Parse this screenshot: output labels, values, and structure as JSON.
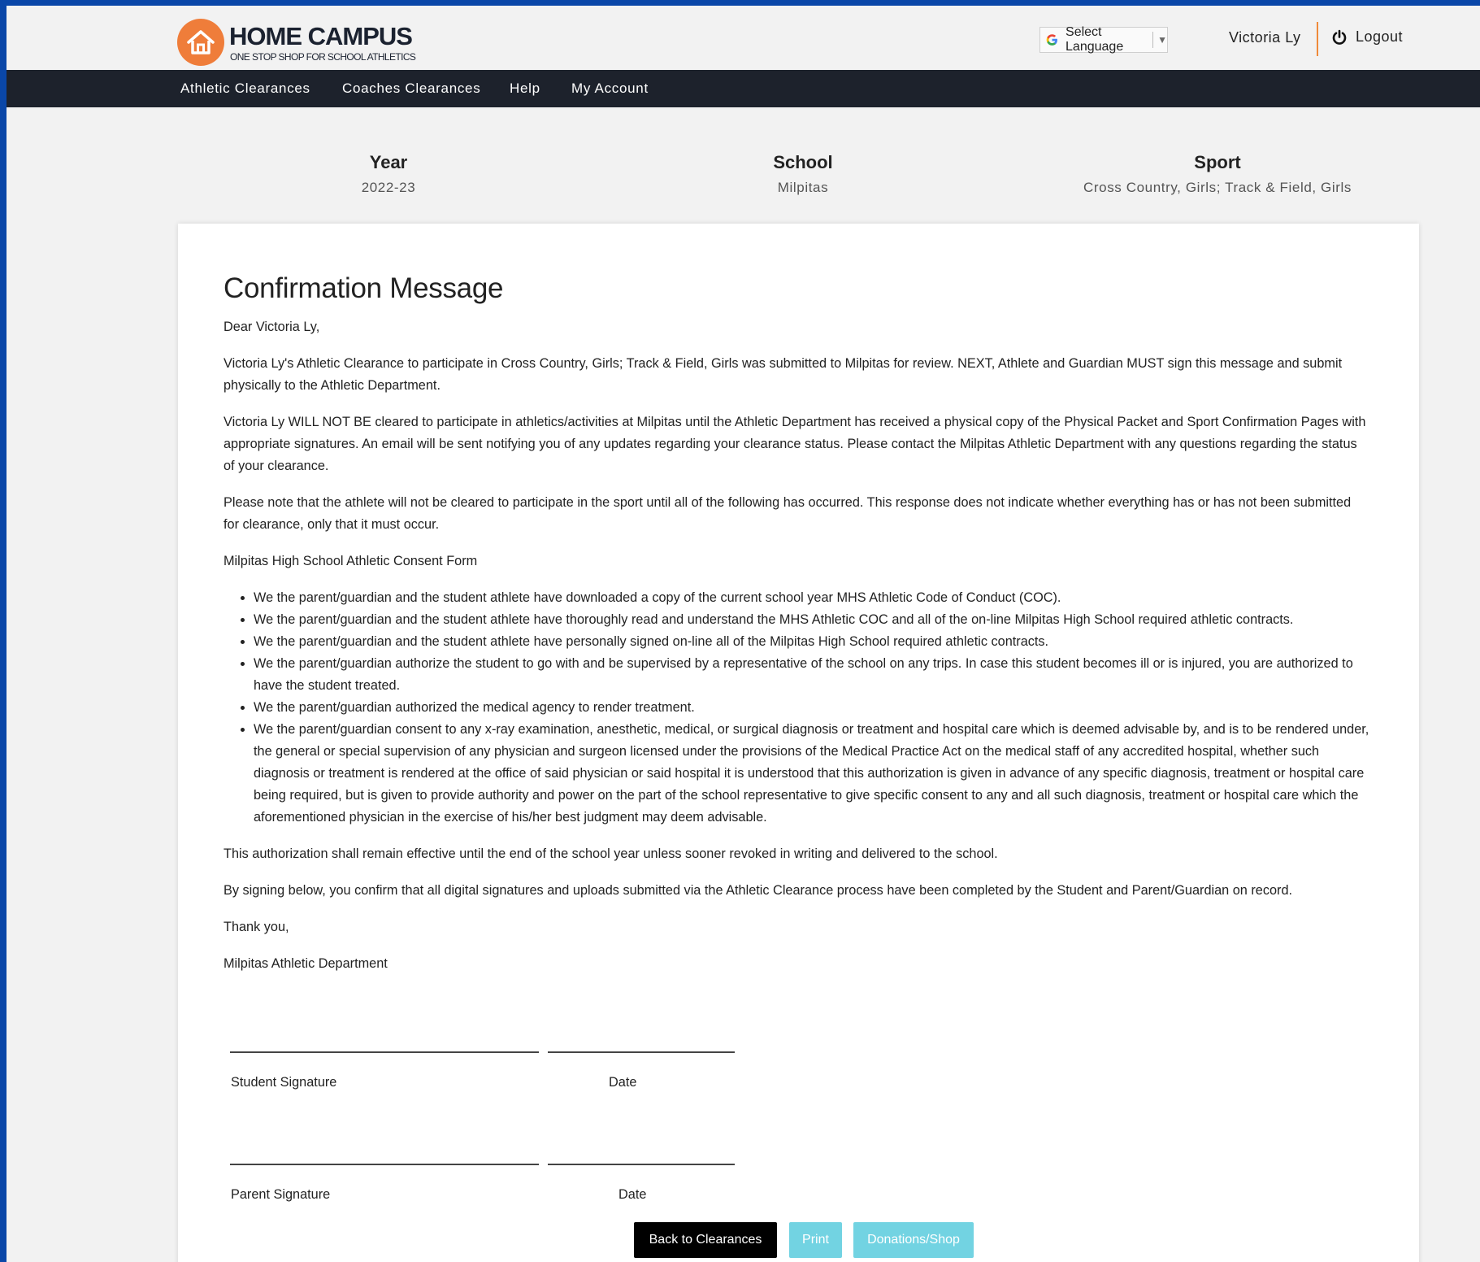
{
  "app": {
    "logo_title": "HOME CAMPUS",
    "logo_tagline": "ONE STOP SHOP FOR SCHOOL ATHLETICS"
  },
  "header": {
    "language_label": "Select Language",
    "user_name": "Victoria Ly",
    "logout_label": "Logout"
  },
  "nav": {
    "items": [
      {
        "label": "Athletic Clearances"
      },
      {
        "label": "Coaches Clearances"
      },
      {
        "label": "Help"
      },
      {
        "label": "My Account"
      }
    ]
  },
  "summary": {
    "year_label": "Year",
    "year_value": "2022-23",
    "school_label": "School",
    "school_value": "Milpitas",
    "sport_label": "Sport",
    "sport_value": "Cross Country, Girls; Track & Field, Girls"
  },
  "message": {
    "title": "Confirmation Message",
    "greeting": "Dear Victoria Ly,",
    "para1": "Victoria Ly's Athletic Clearance to participate in Cross Country, Girls; Track & Field, Girls was submitted to Milpitas for review.  NEXT, Athlete and Guardian MUST sign this message and submit physically to the Athletic Department.",
    "para2": "Victoria Ly WILL NOT BE cleared to participate in athletics/activities at Milpitas until the Athletic Department has received a physical copy of the Physical Packet and Sport Confirmation Pages with appropriate signatures. An email will be sent notifying you of any updates regarding your clearance status. Please contact the Milpitas Athletic Department with any questions regarding the status of your clearance.",
    "para3": "Please note that the athlete will not be cleared to participate in the sport until all of the following has occurred. This response does not indicate whether everything has or has not been submitted for clearance, only that it must occur.",
    "form_title": "Milpitas High School Athletic Consent Form",
    "bullets": [
      "We the parent/guardian and the student athlete have downloaded a copy of the current school year MHS Athletic Code of Conduct (COC).",
      "We the parent/guardian and the student athlete have thoroughly read and understand the MHS Athletic COC and all of the on-line Milpitas High School required athletic contracts.",
      "We the parent/guardian and the student athlete have personally signed on-line all of the Milpitas High School required athletic contracts.",
      "We the parent/guardian authorize the student to go with and be supervised by a representative of the school on any trips. In case this student becomes ill or is injured, you are authorized to have the student treated.",
      "We the parent/guardian authorized the medical agency to render treatment.",
      "We the parent/guardian consent to any x-ray examination, anesthetic, medical, or surgical diagnosis or treatment and hospital care which is deemed advisable by, and is to be rendered under, the general or special supervision of any physician and surgeon licensed under the provisions of the Medical Practice Act on the medical staff of any accredited hospital, whether such diagnosis or treatment is rendered at the office of said physician or said hospital it is understood that this authorization is given in advance of any specific diagnosis, treatment or hospital care being required, but is given to provide authority and power on the part of the school representative to give specific consent to any and all such diagnosis, treatment or hospital care which the aforementioned physician in the exercise of his/her best judgment may deem advisable."
    ],
    "para4": "This authorization shall remain effective until the end of the school year unless sooner revoked in writing and delivered to the school.",
    "para5": "By signing below, you confirm that all digital signatures and uploads submitted via the Athletic Clearance process have been completed by the Student and Parent/Guardian on record.",
    "closing": "Thank you,",
    "sender": "Milpitas Athletic Department"
  },
  "signatures": {
    "student_label": "Student Signature",
    "student_date_label": "Date",
    "parent_label": "Parent Signature",
    "parent_date_label": "Date"
  },
  "buttons": {
    "back_label": "Back to Clearances",
    "print_label": "Print",
    "donations_label": "Donations/Shop"
  },
  "colors": {
    "frame": "#0a47a8",
    "navbar": "#1d222c",
    "logo_orange": "#ef7d3a",
    "button_dark": "#000000",
    "button_light": "#72d3e2"
  },
  "icons": {
    "logo": "house-icon",
    "language": "google-g-icon",
    "logout": "power-icon"
  }
}
